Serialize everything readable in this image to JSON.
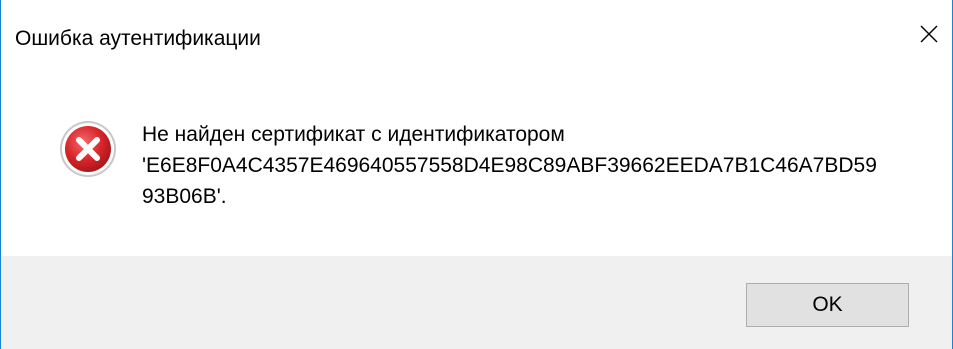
{
  "dialog": {
    "title": "Ошибка аутентификации",
    "close_icon": "close-icon",
    "error_icon": "error-icon",
    "message_lines": [
      "Не найден сертификат с идентификатором",
      "'E6E8F0A4C4357E469640557558D4E98C89ABF39662EEDA7B1C46A7BD59",
      "93B06B'."
    ],
    "ok_label": "OK"
  },
  "colors": {
    "window_border": "#1883d7",
    "footer_bg": "#f0f0f0",
    "button_bg": "#e1e1e1",
    "button_border": "#adadad",
    "error_red": "#d9262b"
  }
}
